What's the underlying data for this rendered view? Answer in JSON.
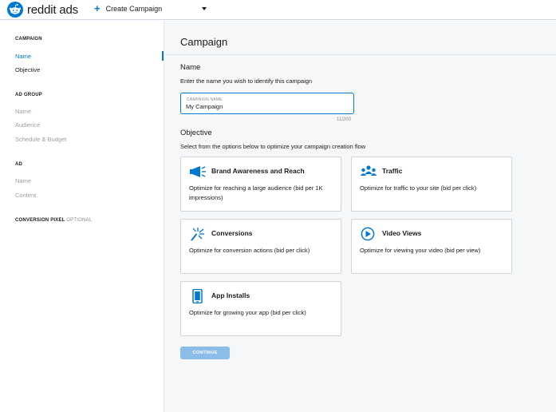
{
  "header": {
    "logo_word": "reddit",
    "logo_ads": "ads",
    "create_label": "Create Campaign"
  },
  "sidebar": {
    "campaign_head": "CAMPAIGN",
    "campaign_items": [
      "Name",
      "Objective"
    ],
    "adgroup_head": "AD GROUP",
    "adgroup_items": [
      "Name",
      "Audience",
      "Schedule & Budget"
    ],
    "ad_head": "AD",
    "ad_items": [
      "Name",
      "Content"
    ],
    "pixel_head": "CONVERSION PIXEL",
    "pixel_optional": "OPTIONAL"
  },
  "main": {
    "title": "Campaign",
    "name_heading": "Name",
    "name_sub": "Enter the name you wish to identify this campaign",
    "input_label": "CAMPAIGN NAME",
    "input_value": "My Campaign",
    "counter": "11/200",
    "objective_heading": "Objective",
    "objective_sub": "Select from the options below to optimize your campaign creation flow",
    "cards": [
      {
        "title": "Brand Awareness and Reach",
        "desc": "Optimize for reaching a large audience (bid per 1K impressions)",
        "icon": "megaphone-icon"
      },
      {
        "title": "Traffic",
        "desc": "Optimize for traffic to your site (bid per click)",
        "icon": "people-icon"
      },
      {
        "title": "Conversions",
        "desc": "Optimize for conversion actions (bid per click)",
        "icon": "cursor-click-icon"
      },
      {
        "title": "Video Views",
        "desc": "Optimize for viewing your video (bid per view)",
        "icon": "play-icon"
      },
      {
        "title": "App Installs",
        "desc": "Optimize for growing your app (bid per click)",
        "icon": "phone-icon"
      }
    ],
    "continue_label": "CONTINUE"
  },
  "colors": {
    "accent": "#0079d3",
    "logo_orange": "#ff4500",
    "continue_disabled": "#8cbce8"
  }
}
